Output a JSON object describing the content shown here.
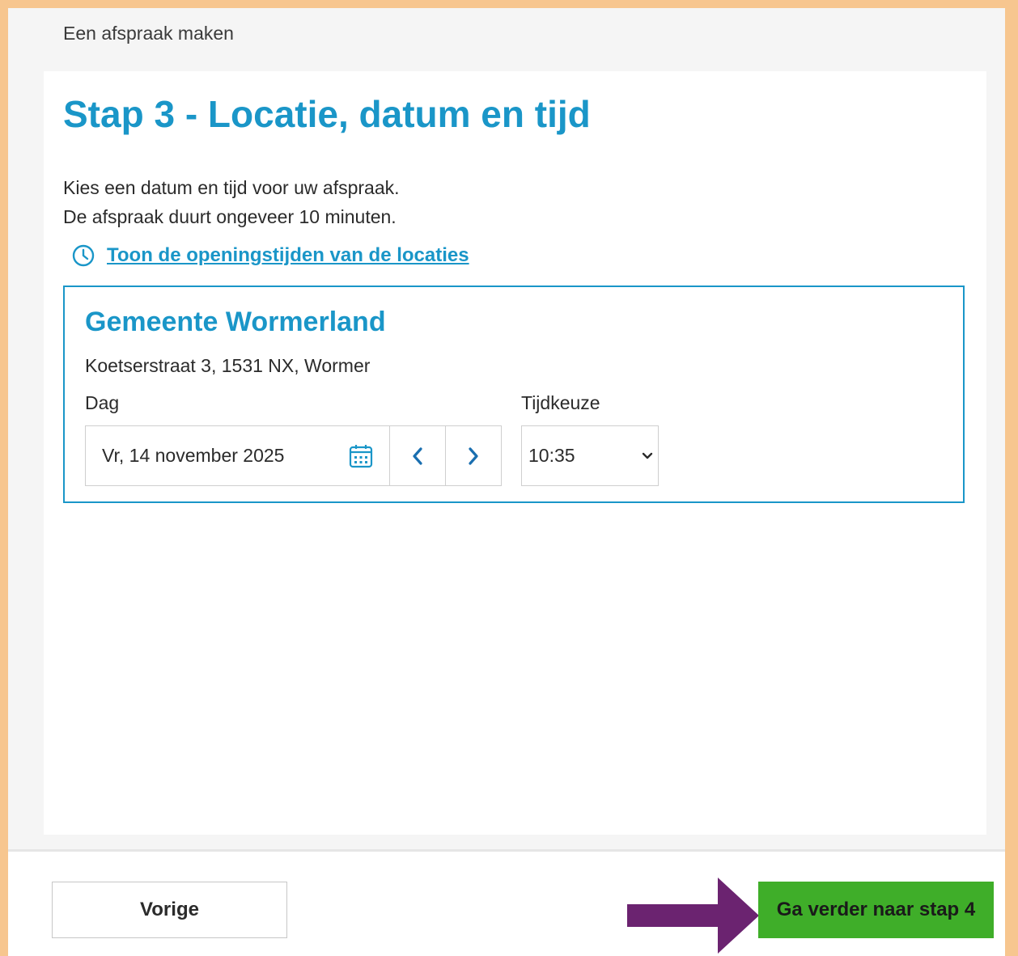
{
  "breadcrumb": "Een afspraak maken",
  "page_title": "Stap 3 - Locatie, datum en tijd",
  "intro": {
    "line1": "Kies een datum en tijd voor uw afspraak.",
    "line2": "De afspraak duurt ongeveer 10 minuten."
  },
  "opening_hours_link": "Toon de openingstijden van de locaties",
  "location": {
    "name": "Gemeente Wormerland",
    "address": "Koetserstraat 3, 1531 NX, Wormer",
    "day_label": "Dag",
    "day_value": "Vr, 14 november 2025",
    "time_label": "Tijdkeuze",
    "time_value": "10:35"
  },
  "footer": {
    "prev_label": "Vorige",
    "next_label": "Ga verder naar stap 4"
  },
  "icons": {
    "clock": "clock-icon",
    "calendar": "calendar-icon",
    "prev_day": "chevron-left-icon",
    "next_day": "chevron-right-icon",
    "time_dropdown": "chevron-down-icon",
    "annotation": "arrow-right-icon"
  },
  "colors": {
    "accent": "#1a96c8",
    "frame": "#f7c68f",
    "next_button": "#3fae29",
    "annotation_arrow": "#6b2370"
  }
}
